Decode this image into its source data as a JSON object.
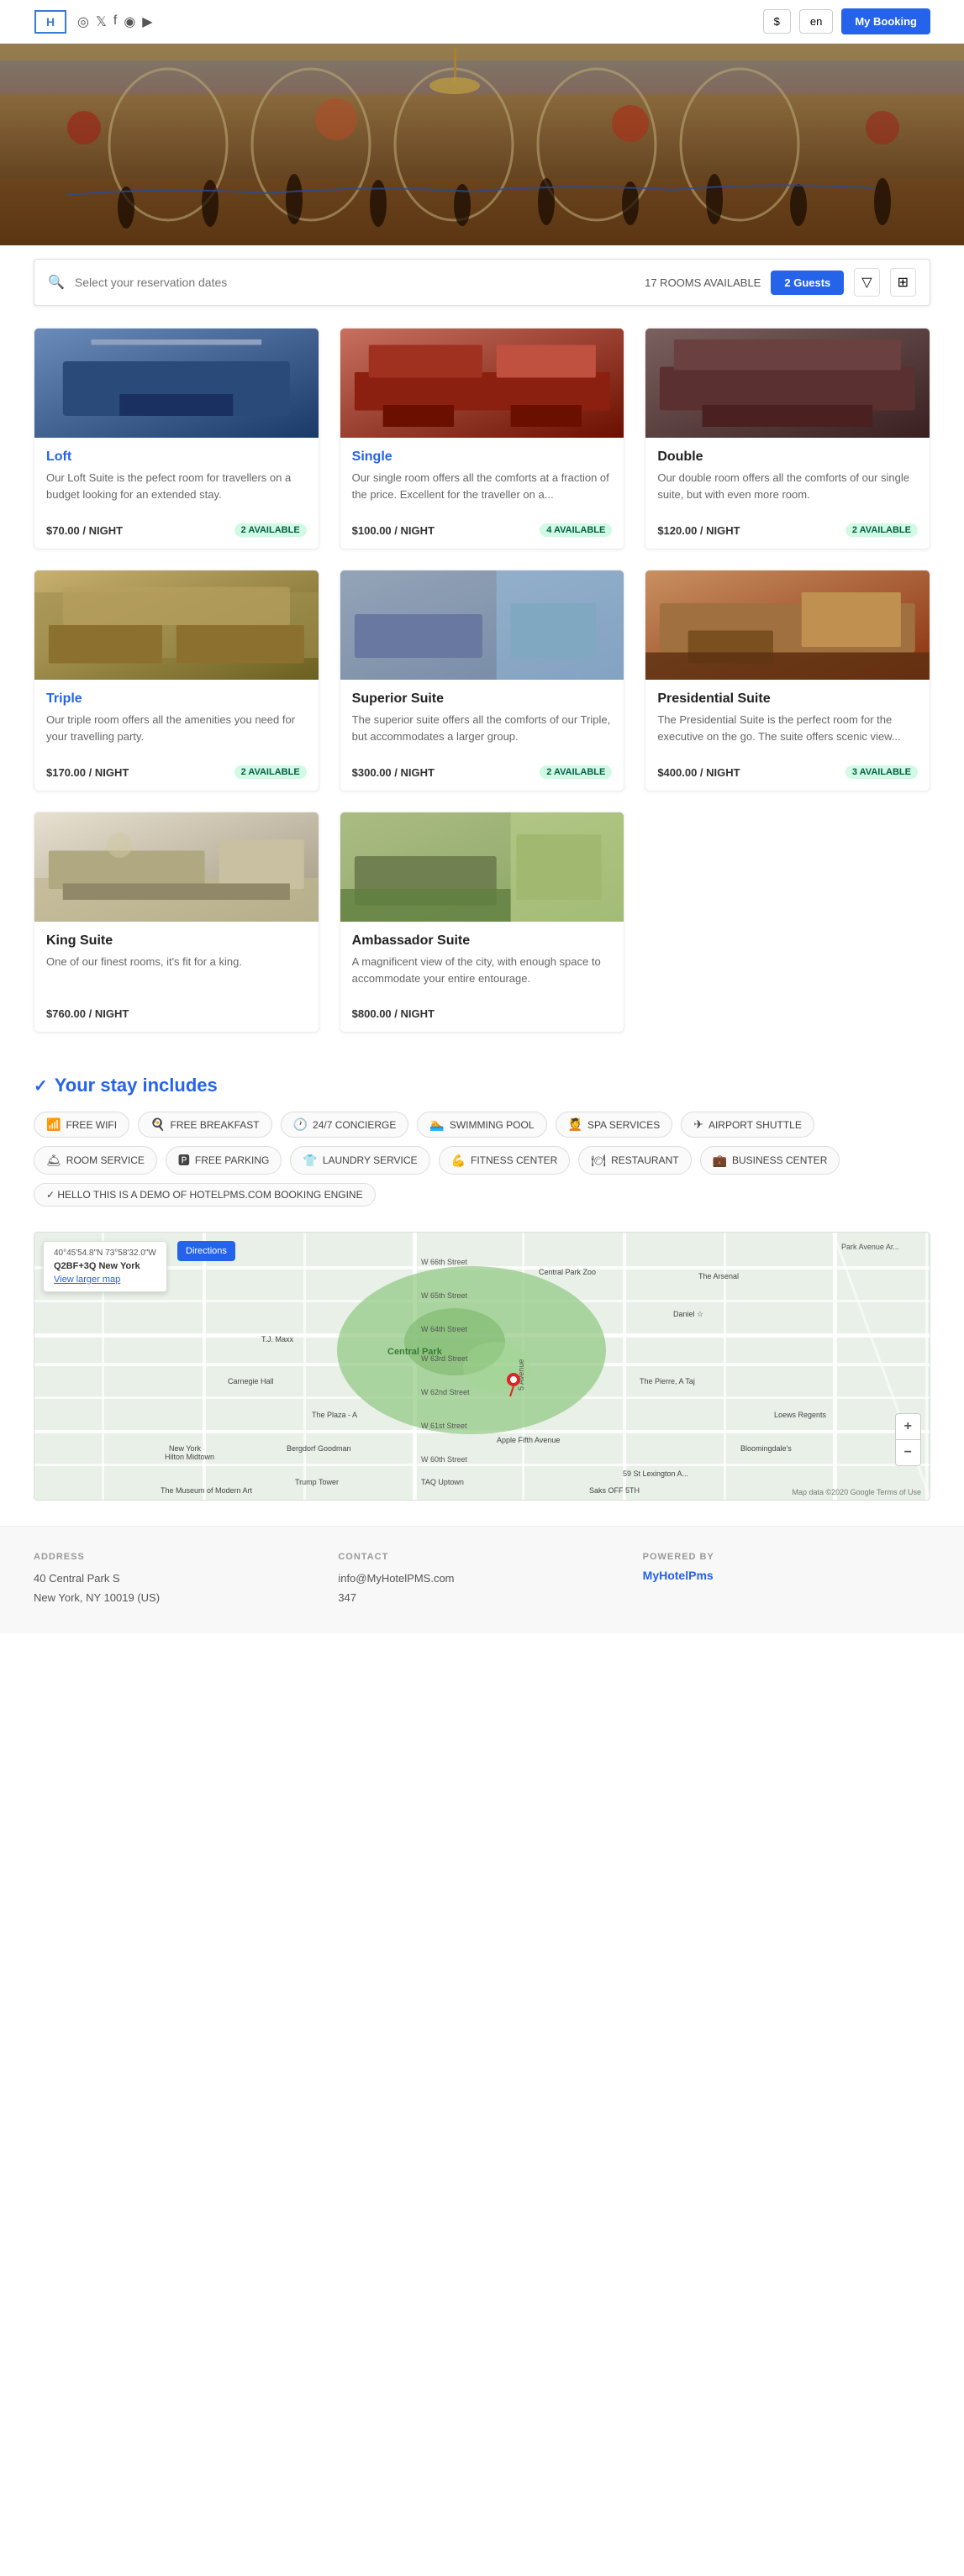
{
  "header": {
    "logo_text": "H",
    "social_icons": [
      "◎",
      "𝕏",
      "f",
      "◉",
      "▶"
    ],
    "currency": "$",
    "language": "en",
    "booking_btn": "My Booking"
  },
  "search": {
    "placeholder": "Select your reservation dates",
    "rooms_available": "17 ROOMS AVAILABLE",
    "guests_btn": "2 Guests",
    "filter_icon": "▽",
    "grid_icon": "⊞"
  },
  "rooms": [
    {
      "name": "Loft",
      "name_class": "featured",
      "description": "Our Loft Suite is the pefect room for travellers on a budget looking for an extended stay.",
      "price": "$70.00 / NIGHT",
      "badge": "2 AVAILABLE",
      "img_class": "room-img-1"
    },
    {
      "name": "Single",
      "name_class": "featured",
      "description": "Our single room offers all the comforts at a fraction of the price. Excellent for the traveller on a...",
      "price": "$100.00 / NIGHT",
      "badge": "4 AVAILABLE",
      "img_class": "room-img-2"
    },
    {
      "name": "Double",
      "name_class": "normal",
      "description": "Our double room offers all the comforts of our single suite, but with even more room.",
      "price": "$120.00 / NIGHT",
      "badge": "2 AVAILABLE",
      "img_class": "room-img-3"
    },
    {
      "name": "Triple",
      "name_class": "featured",
      "description": "Our triple room offers all the amenities you need for your travelling party.",
      "price": "$170.00 / NIGHT",
      "badge": "2 AVAILABLE",
      "img_class": "room-img-4"
    },
    {
      "name": "Superior Suite",
      "name_class": "normal",
      "description": "The superior suite offers all the comforts of our Triple, but accommodates a larger group.",
      "price": "$300.00 / NIGHT",
      "badge": "2 AVAILABLE",
      "img_class": "room-img-5"
    },
    {
      "name": "Presidential Suite",
      "name_class": "normal",
      "description": "The Presidential Suite is the perfect room for the executive on the go. The suite offers scenic view...",
      "price": "$400.00 / NIGHT",
      "badge": "3 AVAILABLE",
      "img_class": "room-img-6"
    },
    {
      "name": "King Suite",
      "name_class": "normal",
      "description": "One of our finest rooms, it's fit for a king.",
      "price": "$760.00 / NIGHT",
      "badge": "",
      "img_class": "room-img-7"
    },
    {
      "name": "Ambassador Suite",
      "name_class": "normal",
      "description": "A magnificent view of the city, with enough space to accommodate your entire entourage.",
      "price": "$800.00 / NIGHT",
      "badge": "",
      "img_class": "room-img-8"
    }
  ],
  "amenities": {
    "title": "Your stay includes",
    "check_icon": "✓",
    "items": [
      {
        "icon": "📶",
        "label": "FREE WIFI"
      },
      {
        "icon": "🍳",
        "label": "FREE BREAKFAST"
      },
      {
        "icon": "🕐",
        "label": "24/7 CONCIERGE"
      },
      {
        "icon": "🏊",
        "label": "SWIMMING POOL"
      },
      {
        "icon": "💆",
        "label": "SPA SERVICES"
      },
      {
        "icon": "✈",
        "label": "AIRPORT SHUTTLE"
      },
      {
        "icon": "🛎",
        "label": "ROOM SERVICE"
      },
      {
        "icon": "🅿",
        "label": "FREE PARKING"
      },
      {
        "icon": "👕",
        "label": "LAUNDRY SERVICE"
      },
      {
        "icon": "💪",
        "label": "FITNESS CENTER"
      },
      {
        "icon": "🍽",
        "label": "RESTAURANT"
      },
      {
        "icon": "💼",
        "label": "BUSINESS CENTER"
      }
    ],
    "demo_text": "✓ HELLO THIS IS A DEMO OF HOTELPMS.COM BOOKING ENGINE"
  },
  "map": {
    "coords": "40°45'54.8\"N 73°58'32.0\"W",
    "plus_code": "Q2BF+3Q New York",
    "view_larger_map": "View larger map",
    "directions_btn": "Directions",
    "pin_icon": "📍",
    "zoom_in": "+",
    "zoom_out": "−",
    "copyright": "Map data ©2020 Google  Terms of Use"
  },
  "footer": {
    "address_label": "ADDRESS",
    "address_lines": [
      "40 Central Park S",
      "New York, NY 10019 (US)"
    ],
    "contact_label": "CONTACT",
    "contact_lines": [
      "info@MyHotelPMS.com",
      "347"
    ],
    "powered_label": "POWERED BY",
    "powered_brand": "MyHotelPms"
  }
}
